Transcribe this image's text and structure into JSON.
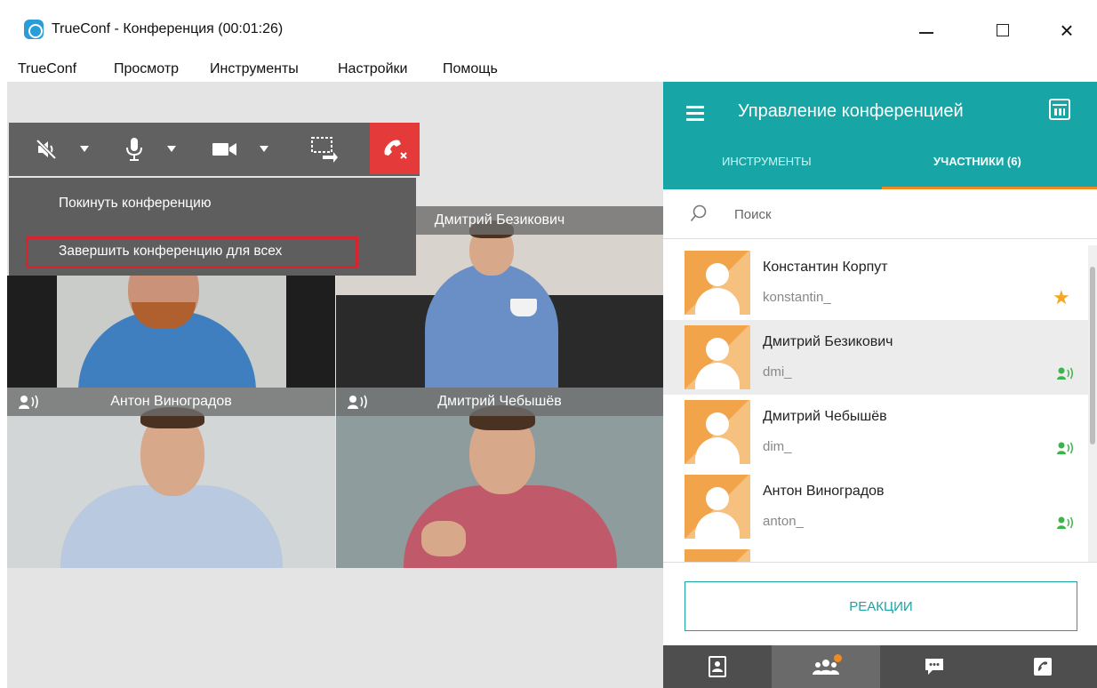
{
  "window": {
    "title": "TrueConf - Конференция (00:01:26)",
    "controls": {
      "minimize_icon": "minimize-icon",
      "maximize_icon": "maximize-icon",
      "close_glyph": "×"
    }
  },
  "menu": {
    "items": [
      "TrueConf",
      "Просмотр",
      "Инструменты",
      "Настройки",
      "Помощь"
    ]
  },
  "toolbar": {
    "icons": [
      "speaker-mute-icon",
      "microphone-icon",
      "camera-icon",
      "share-screen-icon",
      "hangup-icon"
    ]
  },
  "hangup_menu": {
    "items": [
      "Покинуть конференцию",
      "Завершить конференцию для всех"
    ],
    "highlighted_index": 1
  },
  "video_tiles": [
    {
      "name": "Дмитрий Безикович",
      "speaking_icon": false
    },
    {
      "name": "Антон Виноградов",
      "speaking_icon": true
    },
    {
      "name": "Дмитрий Чебышёв",
      "speaking_icon": true
    }
  ],
  "panel": {
    "title": "Управление конференцией",
    "tabs": [
      {
        "label": "ИНСТРУМЕНТЫ",
        "active": false
      },
      {
        "label": "УЧАСТНИКИ (6)",
        "active": true
      }
    ],
    "search": {
      "placeholder": "Поиск",
      "value": ""
    },
    "participants": [
      {
        "name": "Константин Корпут",
        "login": "konstantin_",
        "badge": "star-icon",
        "selected": false
      },
      {
        "name": "Дмитрий Безикович",
        "login": "dmi_",
        "badge": "speaker-active-icon",
        "selected": true
      },
      {
        "name": "Дмитрий Чебышёв",
        "login": "dim_",
        "badge": "speaker-active-icon",
        "selected": false
      },
      {
        "name": "Антон Виноградов",
        "login": "anton_",
        "badge": "speaker-active-icon",
        "selected": false
      }
    ],
    "reactions_label": "РЕАКЦИИ",
    "bottom_tabs": [
      "contacts-icon",
      "participants-icon",
      "chat-icon",
      "call-icon"
    ],
    "bottom_active_index": 1
  },
  "colors": {
    "accent": "#17a5a5",
    "tab_underline": "#f08a24",
    "hangup": "#e53a3a",
    "highlight_border": "#d9232e",
    "avatar": "#f2a44b",
    "star": "#f5a623",
    "speaking": "#3bb54a"
  }
}
